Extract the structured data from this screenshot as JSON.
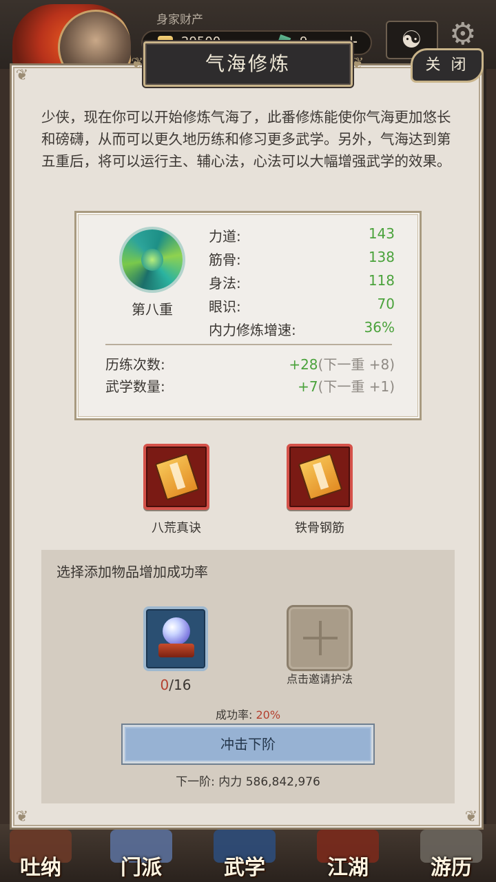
{
  "hud": {
    "wealth_label": "身家财产",
    "coins": "29500",
    "jade": "9",
    "plus": "+"
  },
  "dialog": {
    "title": "气海修炼",
    "close_label": "关 闭",
    "intro": "少侠，现在你可以开始修炼气海了，此番修炼能使你气海更加悠长和磅礴，从而可以更久地历练和修习更多武学。另外，气海达到第五重后，将可以运行主、辅心法，心法可以大幅增强武学的效果。"
  },
  "level": {
    "name": "第八重",
    "stats": [
      {
        "label": "力道:",
        "value": "143"
      },
      {
        "label": "筋骨:",
        "value": "138"
      },
      {
        "label": "身法:",
        "value": "118"
      },
      {
        "label": "眼识:",
        "value": "70"
      },
      {
        "label": "内力修炼增速:",
        "value": "36%"
      }
    ],
    "bonuses": [
      {
        "label": "历练次数:",
        "value": "+28",
        "next": "(下一重 +8)"
      },
      {
        "label": "武学数量:",
        "value": "+7",
        "next": "(下一重 +1)"
      }
    ]
  },
  "books": [
    {
      "name": "八荒真诀"
    },
    {
      "name": "铁骨钢筋"
    }
  ],
  "boost": {
    "title": "选择添加物品增加成功率",
    "item_count_current": "0",
    "item_count_total": "/16",
    "add_label": "点击邀请护法",
    "rate_label": "成功率: ",
    "rate_value": "20%",
    "button_label": "冲击下阶",
    "next_requirement": "下一阶:  内力 586,842,976"
  },
  "nav": [
    {
      "label": "吐纳"
    },
    {
      "label": "门派"
    },
    {
      "label": "武学"
    },
    {
      "label": "江湖"
    },
    {
      "label": "游历"
    }
  ],
  "colors": {
    "stat_green": "#4aa23b",
    "accent_red": "#b4402f",
    "panel_bg": "#e7e1d9",
    "button_blue": "#97b2d3"
  }
}
